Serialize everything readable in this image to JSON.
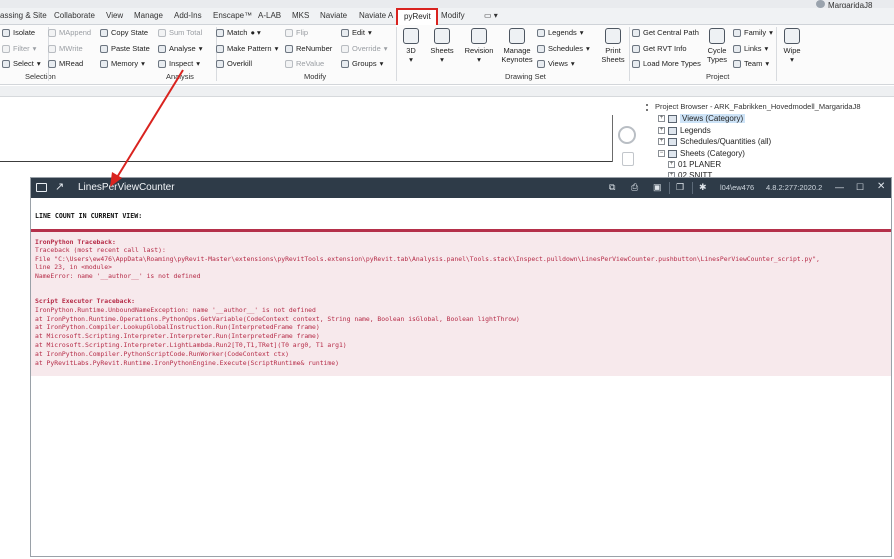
{
  "tabs": [
    "assing & Site",
    "Collaborate",
    "View",
    "Manage",
    "Add-Ins",
    "Enscape™",
    "A-LAB",
    "MKS",
    "Naviate",
    "Naviate A",
    "pyRevit",
    "Modify"
  ],
  "user": {
    "name": "MargaridaJ8"
  },
  "ribbon": {
    "selection": {
      "isolate": "Isolate",
      "filter": "Filter",
      "select": "Select",
      "label": "Selection"
    },
    "analysis": {
      "mappend": "MAppend",
      "mwrite": "MWrite",
      "mread": "MRead",
      "copy_state": "Copy State",
      "paste_state": "Paste State",
      "memory": "Memory",
      "sum_total": "Sum Total",
      "analyse": "Analyse",
      "inspect": "Inspect",
      "label": "Analysis"
    },
    "modify": {
      "match": "Match",
      "make_pattern": "Make Pattern",
      "overkill": "Overkill",
      "flip": "Flip",
      "renumber": "ReNumber",
      "revalue": "ReValue",
      "edit": "Edit",
      "override": "Override",
      "groups": "Groups",
      "label": "Modify"
    },
    "drawing_set": {
      "3d": "3D",
      "sheets": "Sheets",
      "revision": "Revision",
      "manage_keynotes_1": "Manage",
      "manage_keynotes_2": "Keynotes",
      "legends": "Legends",
      "schedules": "Schedules",
      "views": "Views",
      "print_sheets_1": "Print",
      "print_sheets_2": "Sheets",
      "label": "Drawing Set"
    },
    "project": {
      "get_central_path": "Get Central Path",
      "get_rvt_info": "Get RVT Info",
      "load_more_types": "Load More Types",
      "cycle_types_1": "Cycle",
      "cycle_types_2": "Types",
      "family": "Family",
      "links": "Links",
      "team": "Team",
      "label": "Project"
    },
    "wipe": "Wipe"
  },
  "project_browser": {
    "title": "Project Browser - ARK_Fabrikken_Hovedmodell_MargaridaJ8",
    "items": [
      "Views (Category)",
      "Legends",
      "Schedules/Quantities (all)",
      "Sheets (Category)",
      "01 PLANER",
      "02 SNITT"
    ]
  },
  "output_window": {
    "title": "LinesPerViewCounter",
    "user": "l04\\ew476",
    "version": "4.8.2:277:2020.2",
    "heading": "LINE COUNT IN CURRENT VIEW:",
    "error_lines": [
      "IronPython Traceback:",
      "Traceback (most recent call last):",
      "File \"C:\\Users\\ew476\\AppData\\Roaming\\pyRevit-Master\\extensions\\pyRevitTools.extension\\pyRevit.tab\\Analysis.panel\\Tools.stack\\Inspect.pulldown\\LinesPerViewCounter.pushbutton\\LinesPerViewCounter_script.py\",",
      "line 23, in <module>",
      "NameError: name '__author__' is not defined",
      "",
      "Script Executor Traceback:",
      "IronPython.Runtime.UnboundNameException: name '__author__' is not defined",
      "at IronPython.Runtime.Operations.PythonOps.GetVariable(CodeContext context, String name, Boolean isGlobal, Boolean lightThrow)",
      "at IronPython.Compiler.LookupGlobalInstruction.Run(InterpretedFrame frame)",
      "at Microsoft.Scripting.Interpreter.Interpreter.Run(InterpretedFrame frame)",
      "at Microsoft.Scripting.Interpreter.LightLambda.Run2[T0,T1,TRet](T0 arg0, T1 arg1)",
      "at IronPython.Compiler.PythonScriptCode.RunWorker(CodeContext ctx)",
      "at PyRevitLabs.PyRevit.Runtime.IronPythonEngine.Execute(ScriptRuntime& runtime)"
    ]
  },
  "colors": {
    "annotation_red": "#d9231f",
    "output_titlebar": "#2e3b48",
    "error_text": "#b52a46",
    "error_background": "#f7e9ec"
  }
}
